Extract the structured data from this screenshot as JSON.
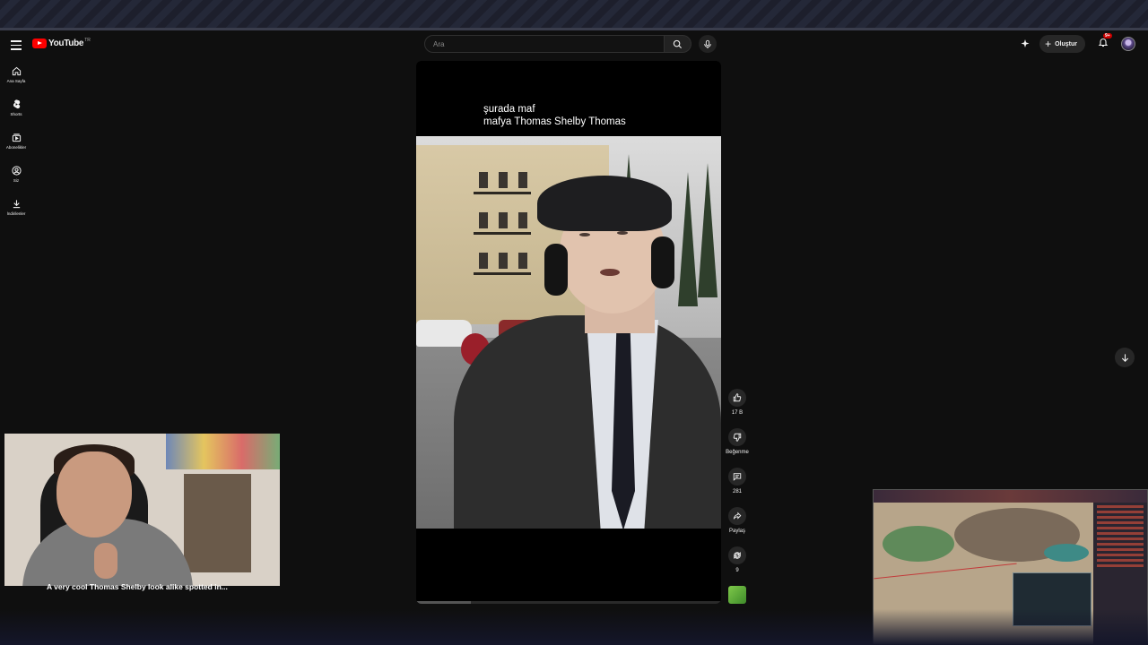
{
  "header": {
    "logo_text": "YouTube",
    "logo_region": "TR",
    "search_placeholder": "Ara",
    "create_label": "Oluştur",
    "notification_count": "9+"
  },
  "nav": {
    "items": [
      {
        "label": "Ana Sayfa",
        "icon": "home-icon"
      },
      {
        "label": "Shorts",
        "icon": "shorts-icon"
      },
      {
        "label": "Abonelikler",
        "icon": "subscriptions-icon"
      },
      {
        "label": "Siz",
        "icon": "you-icon"
      },
      {
        "label": "İndirilenler",
        "icon": "download-icon"
      }
    ]
  },
  "short": {
    "caption_line1": "şurada maf",
    "caption_line2": "mafya Thomas Shelby Thomas",
    "progress": 0.18
  },
  "actions": {
    "like_count": "17 B",
    "dislike_label": "Beğenme",
    "comment_count": "281",
    "share_label": "Paylaş",
    "remix_count": "9"
  },
  "overlay": {
    "webcam_caption": "A very cool Thomas Shelby look alike spotted in..."
  },
  "colors": {
    "background": "#0f0f0f",
    "accent": "#ff0000",
    "button_bg": "#272727",
    "notification_badge": "#cc0000"
  }
}
